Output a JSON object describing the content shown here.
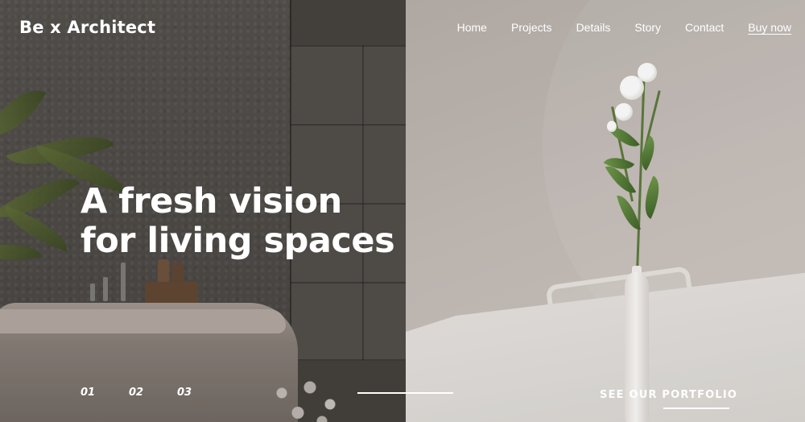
{
  "brand": {
    "logo": "Be x Architect"
  },
  "nav": {
    "home": "Home",
    "projects": "Projects",
    "details": "Details",
    "story": "Story",
    "contact": "Contact",
    "buy_now": "Buy now"
  },
  "hero": {
    "headline_line1": "A fresh vision",
    "headline_line2": "for living spaces",
    "images": [
      "bathroom-photo",
      "dining-room-photo"
    ]
  },
  "slider": {
    "slides": [
      "01",
      "02",
      "03"
    ],
    "active_index": 0
  },
  "cta": {
    "portfolio_label": "SEE OUR PORTFOLIO"
  },
  "colors": {
    "text": "#ffffff",
    "accent_line": "#ffffff"
  }
}
